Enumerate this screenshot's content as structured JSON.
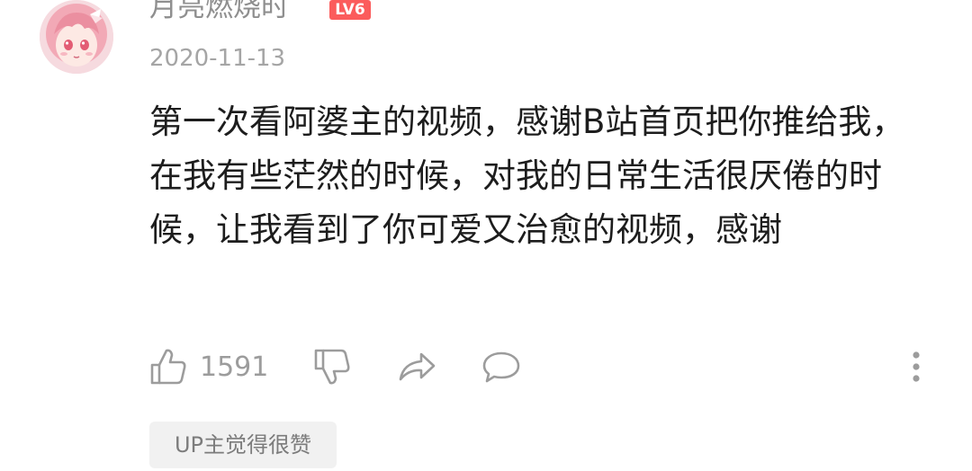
{
  "comment": {
    "username": "月亮燃烧时",
    "level": "LV6",
    "date": "2020-11-13",
    "text": "第一次看阿婆主的视频，感谢B站首页把你推给我，在我有些茫然的时候，对我的日常生活很厌倦的时候，让我看到了你可爱又治愈的视频，感谢",
    "like_count": "1591",
    "up_tag": "UP主觉得很赞"
  },
  "icons": {
    "like": "thumbs-up-icon",
    "dislike": "thumbs-down-icon",
    "share": "share-icon",
    "reply": "comment-icon",
    "more": "more-vertical-icon"
  },
  "colors": {
    "level_badge": "#fb5c5c",
    "icon_gray": "#9c9c9c",
    "tag_bg": "#f1f1f1"
  }
}
